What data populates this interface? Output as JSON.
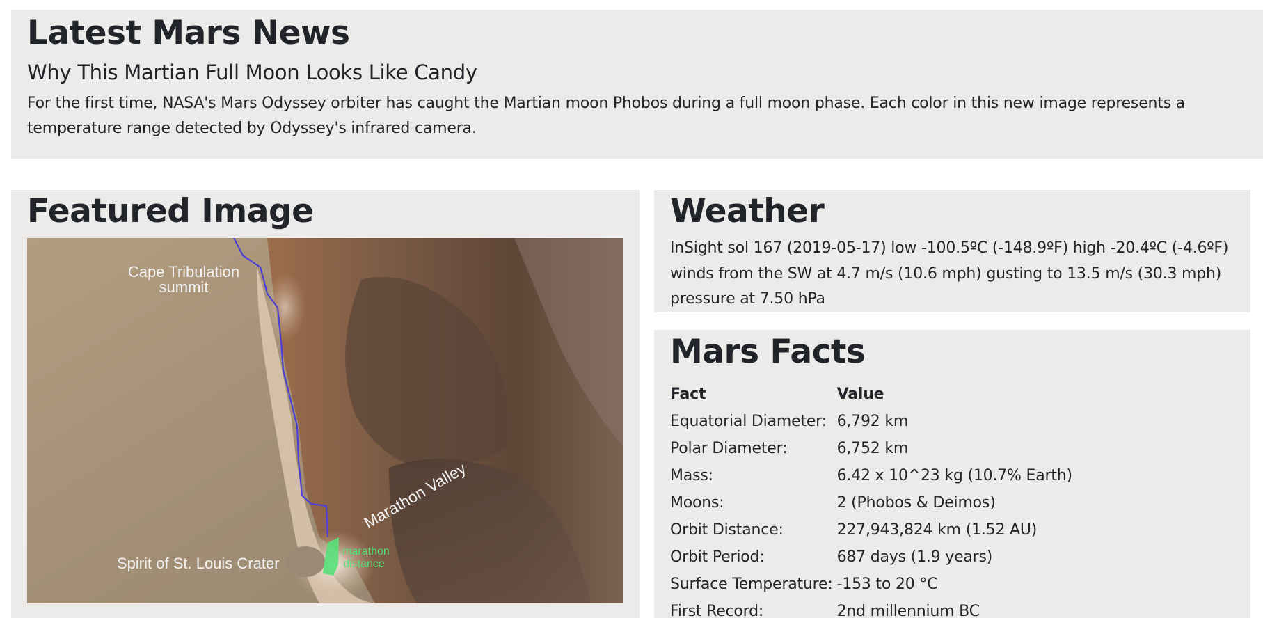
{
  "news": {
    "heading": "Latest Mars News",
    "title": "Why This Martian Full Moon Looks Like Candy",
    "body": "For the first time, NASA's Mars Odyssey orbiter has caught the Martian moon Phobos during a full moon phase. Each color in this new image represents a temperature range detected by Odyssey's infrared camera."
  },
  "featured": {
    "heading": "Featured Image",
    "image_labels": {
      "cape": "Cape Tribulation",
      "cape_2": "summit",
      "valley": "Marathon Valley",
      "crater": "Spirit of St. Louis Crater",
      "marathon": "marathon",
      "marathon_2": "distance"
    }
  },
  "weather": {
    "heading": "Weather",
    "line1": "InSight sol 167 (2019-05-17) low -100.5ºC (-148.9ºF) high -20.4ºC (-4.6ºF)",
    "line2": "winds from the SW at 4.7 m/s (10.6 mph) gusting to 13.5 m/s (30.3 mph)",
    "line3": "pressure at 7.50 hPa"
  },
  "facts": {
    "heading": "Mars Facts",
    "columns": [
      "Fact",
      "Value"
    ],
    "rows": [
      [
        "Equatorial Diameter:",
        "6,792 km"
      ],
      [
        "Polar Diameter:",
        "6,752 km"
      ],
      [
        "Mass:",
        "6.42 x 10^23 kg (10.7% Earth)"
      ],
      [
        "Moons:",
        "2 (Phobos & Deimos)"
      ],
      [
        "Orbit Distance:",
        "227,943,824 km (1.52 AU)"
      ],
      [
        "Orbit Period:",
        "687 days (1.9 years)"
      ],
      [
        "Surface Temperature:",
        "-153 to 20 °C"
      ],
      [
        "First Record:",
        "2nd millennium BC"
      ]
    ]
  }
}
